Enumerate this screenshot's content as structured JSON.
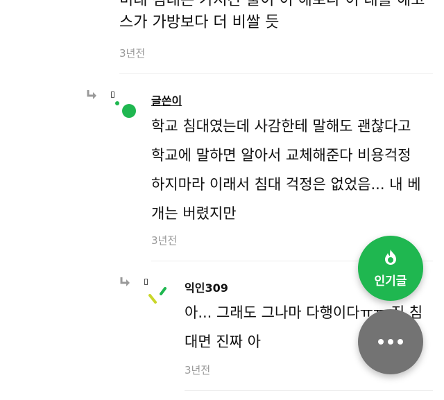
{
  "top_comment": {
    "line1_partial": "미래 침대는 가져간 줄이 이 해보다 이 대를 해고",
    "line2": "스가 가방보다 더 비쌀 듯",
    "time": "3년전"
  },
  "reply1": {
    "author": "글쓴이",
    "lines": [
      "학교 침대였는데 사감한테 말해도 괜찮다고",
      "학교에 말하면 알아서 교체해준다 비용걱정",
      "하지마라 이래서 침대 걱정은 없었음... 내 베",
      "개는 버렸지만"
    ],
    "time": "3년전"
  },
  "reply2": {
    "author": "익인309",
    "lines": [
      "아... 그래도 그나마 다행이다ㅠㅠ 진 침",
      "대면 진짜 아"
    ],
    "time": "3년전"
  },
  "fab": {
    "hot_label": "인기글",
    "hot_icon": "fire-icon",
    "more_icon": "more-dots-icon"
  },
  "colors": {
    "accent_green": "#1fb750",
    "fab_gray": "#737373"
  }
}
